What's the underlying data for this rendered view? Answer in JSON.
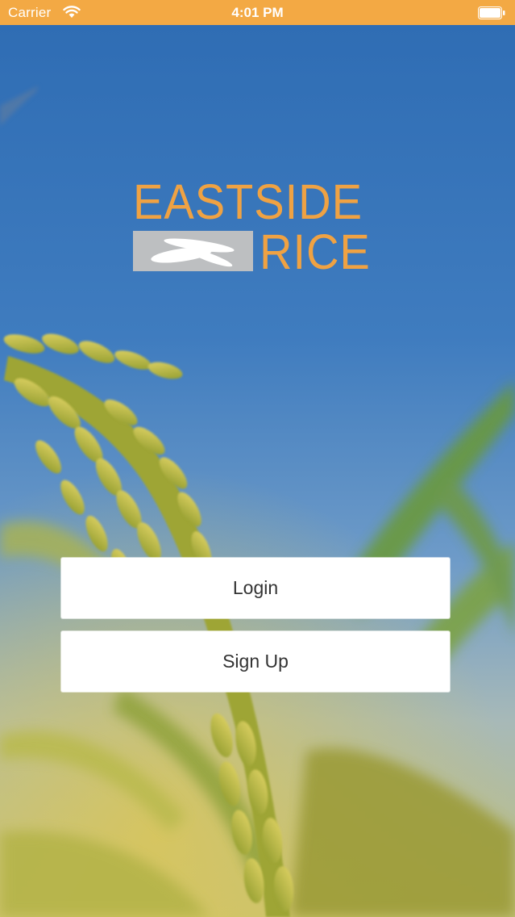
{
  "status_bar": {
    "carrier": "Carrier",
    "time": "4:01 PM",
    "background": "#f3a944"
  },
  "logo": {
    "line1": "EASTSIDE",
    "line2": "RICE",
    "color": "#efa243"
  },
  "actions": {
    "login_label": "Login",
    "signup_label": "Sign Up"
  },
  "icons": {
    "wifi": "wifi-icon",
    "battery": "battery-icon",
    "rice_grain": "rice-grain-icon"
  }
}
